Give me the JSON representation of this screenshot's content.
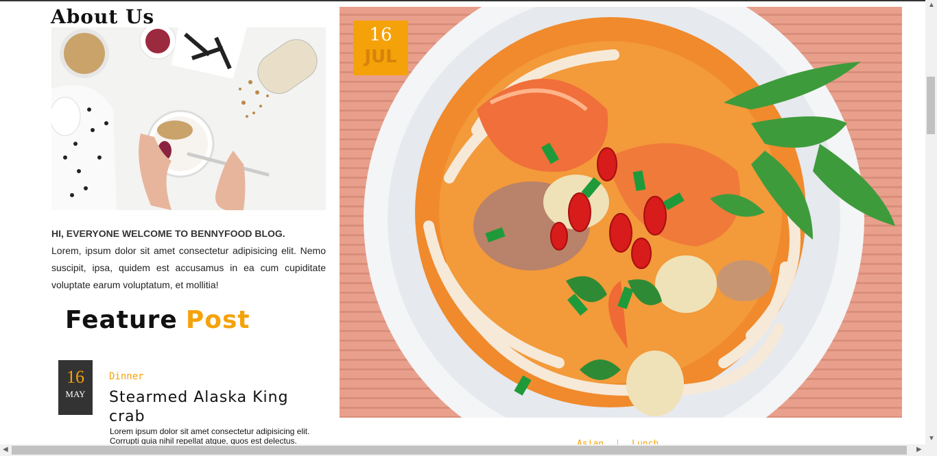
{
  "about": {
    "title": "About Us",
    "intro_heading": "HI, EVERYONE WELCOME TO BENNYFOOD BLOG.",
    "intro_text": "Lorem, ipsum dolor sit amet consectetur adipisicing elit. Nemo suscipit, ipsa, quidem est accusamus in ea cum cupiditate voluptate earum voluptatum, et mollitia!"
  },
  "feature": {
    "word1": "Feature",
    "word2": "Post"
  },
  "post": {
    "day": "16",
    "month": "MAY",
    "category": "Dinner",
    "title": "Stearmed Alaska King crab",
    "excerpt": "Lorem ipsum dolor sit amet consectetur adipisicing elit. Corrupti quia nihil repellat atque, quos est delectus."
  },
  "hero": {
    "day": "16",
    "month": "JUL"
  },
  "tags": [
    "Asian",
    "Lunch"
  ],
  "colors": {
    "accent": "#f5a20a",
    "dark": "#333333"
  }
}
